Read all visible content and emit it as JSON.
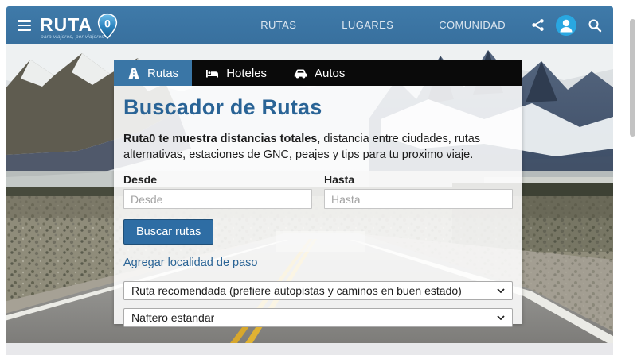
{
  "navbar": {
    "brand": "RUTA",
    "brand_zero": "0",
    "tagline": "para viajeros, por viajeros",
    "links": [
      {
        "label": "RUTAS"
      },
      {
        "label": "LUGARES"
      },
      {
        "label": "COMUNIDAD"
      }
    ]
  },
  "card": {
    "tabs": [
      {
        "label": "Rutas",
        "icon": "road-icon",
        "active": true
      },
      {
        "label": "Hoteles",
        "icon": "bed-icon",
        "active": false
      },
      {
        "label": "Autos",
        "icon": "car-icon",
        "active": false
      }
    ],
    "title": "Buscador de Rutas",
    "intro_bold": "Ruta0 te muestra distancias totales",
    "intro_rest": ", distancia entre ciudades, rutas alternativas, estaciones de GNC, peajes y tips para tu proximo viaje.",
    "from_field": {
      "label": "Desde",
      "placeholder": "Desde",
      "value": ""
    },
    "to_field": {
      "label": "Hasta",
      "placeholder": "Hasta",
      "value": ""
    },
    "submit_label": "Buscar rutas",
    "waypoint_link": "Agregar localidad de paso",
    "route_select": {
      "selected": "Ruta recomendada (prefiere autopistas y caminos en buen estado)"
    },
    "fuel_select": {
      "selected": "Naftero estandar"
    }
  },
  "colors": {
    "navbar": "#38709e",
    "navbar-light": "#3f7aa9",
    "tab-active": "#3a76a6",
    "accent": "#2a6496",
    "button": "#2e6da4",
    "avatar": "#29a7e1"
  }
}
